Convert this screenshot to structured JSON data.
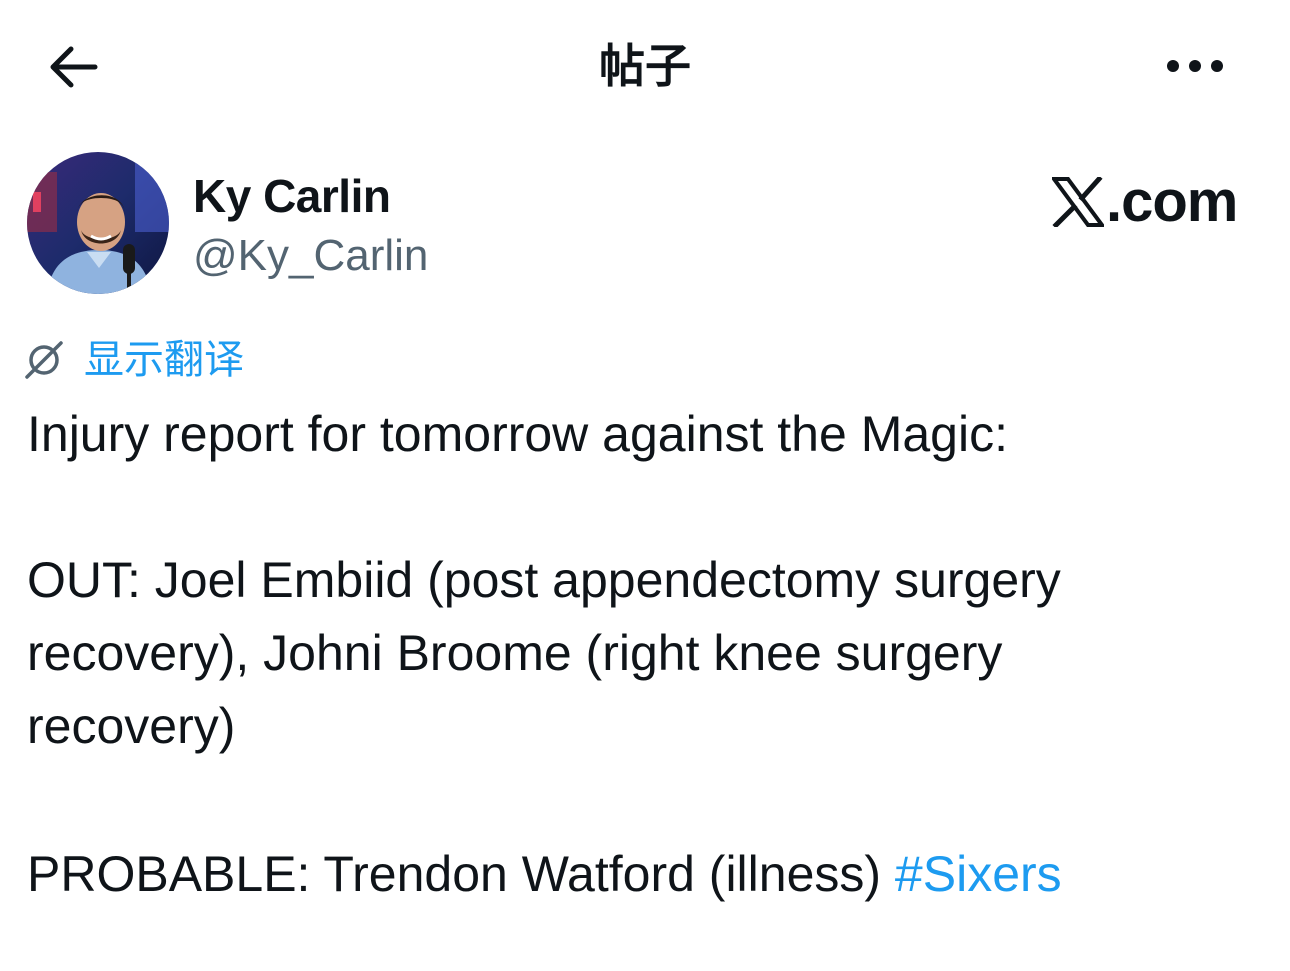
{
  "header": {
    "title": "帖子",
    "back_icon": "arrow-left-icon",
    "more_icon": "more-horizontal-icon"
  },
  "author": {
    "name": "Ky Carlin",
    "handle": "@Ky_Carlin",
    "avatar_icon": "profile-photo"
  },
  "brand": {
    "logo_icon": "x-logo-icon",
    "text": ".com"
  },
  "translate": {
    "icon": "translate-globe-icon",
    "label": "显示翻译"
  },
  "post": {
    "lines": [
      "Injury report for tomorrow against the Magic:",
      "OUT: Joel Embiid (post appendectomy surgery",
      "recovery), Johni Broome (right knee surgery",
      "recovery)",
      "PROBABLE: Trendon Watford (illness) "
    ],
    "hashtag": "#Sixers"
  },
  "colors": {
    "text": "#0f1419",
    "secondary": "#536471",
    "accent": "#1d9bf0",
    "background": "#ffffff"
  }
}
